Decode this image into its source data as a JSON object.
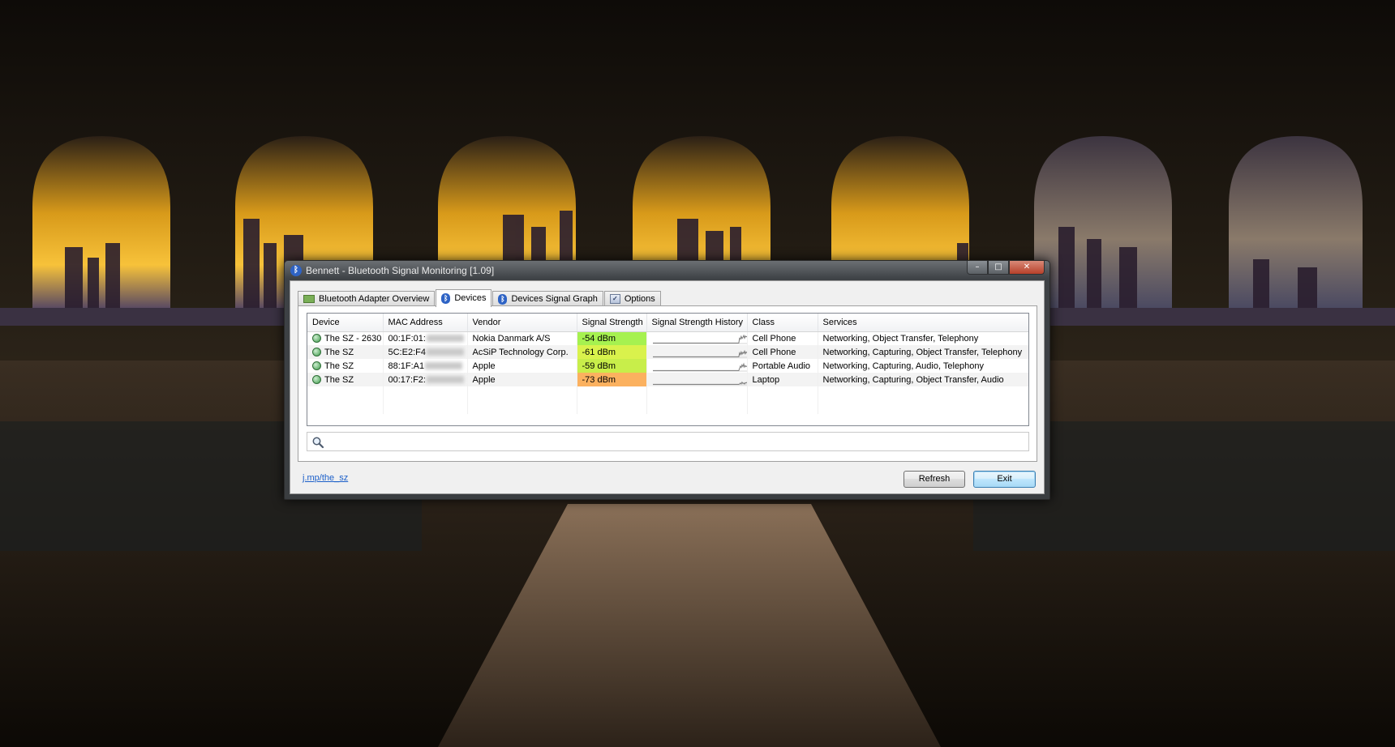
{
  "window": {
    "title": "Bennett - Bluetooth Signal Monitoring [1.09]",
    "controls": {
      "minimize": "–",
      "maximize": "□",
      "close": "✕"
    }
  },
  "tabs": [
    {
      "label": "Bluetooth Adapter Overview",
      "icon": "adapter-icon",
      "active": false
    },
    {
      "label": "Devices",
      "icon": "bluetooth-icon",
      "active": true
    },
    {
      "label": "Devices Signal Graph",
      "icon": "bluetooth-icon",
      "active": false
    },
    {
      "label": "Options",
      "icon": "options-icon",
      "active": false
    }
  ],
  "devices": {
    "columns": [
      "Device",
      "MAC Address",
      "Vendor",
      "Signal Strength",
      "Signal Strength History",
      "Class",
      "Services"
    ],
    "rows": [
      {
        "device": "The SZ - 2630",
        "mac": "00:1F:01:",
        "vendor": "Nokia Danmark A/S",
        "signal": "-54 dBm",
        "signal_color": "#a6f150",
        "history": [
          0.05,
          0.05,
          0.05,
          0.05,
          0.05,
          0.05,
          0.05,
          0.05,
          0.05,
          0.05,
          0.05,
          0.05,
          0.05,
          0.05,
          0.05,
          0.05,
          0.05,
          0.05,
          0.05,
          0.05,
          0.05,
          0.05,
          0.05,
          0.05,
          0.05,
          0.05,
          0.05,
          0.05,
          0.05,
          0.05,
          0.05,
          0.05,
          0.05,
          0.05,
          0.05,
          0.05,
          0.05,
          0.05,
          0.05,
          0.05,
          0.05,
          0.05,
          0.05,
          0.05,
          0.05,
          0.05,
          0.05,
          0.05,
          0.05,
          0.05,
          0.05,
          0.05,
          0.05,
          0.05,
          0.05,
          0.05,
          0.05,
          0.05,
          0.05,
          0.05,
          0.05,
          0.05,
          0.05,
          0.05,
          0.05,
          0.05,
          0.05,
          0.05,
          0.05,
          0.05,
          0.05,
          0.05,
          0.05,
          0.05,
          0.05,
          0.05,
          0.05,
          0.05,
          0.05,
          0.05,
          0.05,
          0.05,
          0.05,
          0.05,
          0.05,
          0.05,
          0.05,
          0.05,
          0.05,
          0.05,
          0.05,
          0.05,
          0.05,
          0.05,
          0.05,
          0.05,
          0.05,
          0.05,
          0.05,
          0.05,
          0.05,
          0.05,
          0.05,
          0.05,
          0.05,
          0.05,
          0.6,
          0.5,
          0.8,
          0.55,
          0.7,
          0.9,
          0.6,
          0.85,
          0.75,
          0.8
        ],
        "class": "Cell Phone",
        "services": "Networking, Object Transfer, Telephony"
      },
      {
        "device": "The SZ",
        "mac": "5C:E2:F4",
        "vendor": "AcSiP Technology Corp.",
        "signal": "-61 dBm",
        "signal_color": "#d9f24c",
        "history": [
          0.05,
          0.05,
          0.05,
          0.05,
          0.05,
          0.05,
          0.05,
          0.05,
          0.05,
          0.05,
          0.05,
          0.05,
          0.05,
          0.05,
          0.05,
          0.05,
          0.05,
          0.05,
          0.05,
          0.05,
          0.05,
          0.05,
          0.05,
          0.05,
          0.05,
          0.05,
          0.05,
          0.05,
          0.05,
          0.05,
          0.05,
          0.05,
          0.05,
          0.05,
          0.05,
          0.05,
          0.05,
          0.05,
          0.05,
          0.05,
          0.05,
          0.05,
          0.05,
          0.05,
          0.05,
          0.05,
          0.05,
          0.05,
          0.05,
          0.05,
          0.05,
          0.05,
          0.05,
          0.05,
          0.05,
          0.05,
          0.05,
          0.05,
          0.05,
          0.05,
          0.05,
          0.05,
          0.05,
          0.05,
          0.05,
          0.05,
          0.05,
          0.05,
          0.05,
          0.05,
          0.05,
          0.05,
          0.05,
          0.05,
          0.05,
          0.05,
          0.05,
          0.05,
          0.05,
          0.05,
          0.05,
          0.05,
          0.05,
          0.05,
          0.05,
          0.05,
          0.05,
          0.05,
          0.05,
          0.05,
          0.05,
          0.05,
          0.05,
          0.05,
          0.05,
          0.05,
          0.05,
          0.05,
          0.05,
          0.05,
          0.05,
          0.05,
          0.05,
          0.05,
          0.05,
          0.05,
          0.5,
          0.3,
          0.6,
          0.35,
          0.55,
          0.45,
          0.7,
          0.4,
          0.6,
          0.5
        ],
        "class": "Cell Phone",
        "services": "Networking, Capturing, Object Transfer, Telephony"
      },
      {
        "device": "The SZ",
        "mac": "88:1F:A1",
        "vendor": "Apple",
        "signal": "-59 dBm",
        "signal_color": "#c8ee4a",
        "history": [
          0.05,
          0.05,
          0.05,
          0.05,
          0.05,
          0.05,
          0.05,
          0.05,
          0.05,
          0.05,
          0.05,
          0.05,
          0.05,
          0.05,
          0.05,
          0.05,
          0.05,
          0.05,
          0.05,
          0.05,
          0.05,
          0.05,
          0.05,
          0.05,
          0.05,
          0.05,
          0.05,
          0.05,
          0.05,
          0.05,
          0.05,
          0.05,
          0.05,
          0.05,
          0.05,
          0.05,
          0.05,
          0.05,
          0.05,
          0.05,
          0.05,
          0.05,
          0.05,
          0.05,
          0.05,
          0.05,
          0.05,
          0.05,
          0.05,
          0.05,
          0.05,
          0.05,
          0.05,
          0.05,
          0.05,
          0.05,
          0.05,
          0.05,
          0.05,
          0.05,
          0.05,
          0.05,
          0.05,
          0.05,
          0.05,
          0.05,
          0.05,
          0.05,
          0.05,
          0.05,
          0.05,
          0.05,
          0.05,
          0.05,
          0.05,
          0.05,
          0.05,
          0.05,
          0.05,
          0.05,
          0.05,
          0.05,
          0.05,
          0.05,
          0.05,
          0.05,
          0.05,
          0.05,
          0.05,
          0.05,
          0.05,
          0.05,
          0.05,
          0.05,
          0.05,
          0.05,
          0.05,
          0.05,
          0.05,
          0.05,
          0.05,
          0.05,
          0.05,
          0.05,
          0.05,
          0.05,
          0.3,
          0.55,
          0.4,
          0.7,
          0.5,
          0.8,
          0.45,
          0.6,
          0.5,
          0.55
        ],
        "class": "Portable Audio",
        "services": "Networking, Capturing, Audio, Telephony"
      },
      {
        "device": "The SZ",
        "mac": "00:17:F2:",
        "vendor": "Apple",
        "signal": "-73 dBm",
        "signal_color": "#fbb15f",
        "history": [
          0.05,
          0.05,
          0.05,
          0.05,
          0.05,
          0.05,
          0.05,
          0.05,
          0.05,
          0.05,
          0.05,
          0.05,
          0.05,
          0.05,
          0.05,
          0.05,
          0.05,
          0.05,
          0.05,
          0.05,
          0.05,
          0.05,
          0.05,
          0.05,
          0.05,
          0.05,
          0.05,
          0.05,
          0.05,
          0.05,
          0.05,
          0.05,
          0.05,
          0.05,
          0.05,
          0.05,
          0.05,
          0.05,
          0.05,
          0.05,
          0.05,
          0.05,
          0.05,
          0.05,
          0.05,
          0.05,
          0.05,
          0.05,
          0.05,
          0.05,
          0.05,
          0.05,
          0.05,
          0.05,
          0.05,
          0.05,
          0.05,
          0.05,
          0.05,
          0.05,
          0.05,
          0.05,
          0.05,
          0.05,
          0.05,
          0.05,
          0.05,
          0.05,
          0.05,
          0.05,
          0.05,
          0.05,
          0.05,
          0.05,
          0.05,
          0.05,
          0.05,
          0.05,
          0.05,
          0.05,
          0.05,
          0.05,
          0.05,
          0.05,
          0.05,
          0.05,
          0.05,
          0.05,
          0.05,
          0.05,
          0.05,
          0.05,
          0.05,
          0.05,
          0.05,
          0.05,
          0.05,
          0.05,
          0.05,
          0.05,
          0.05,
          0.05,
          0.05,
          0.05,
          0.05,
          0.05,
          0.1,
          0.2,
          0.1,
          0.3,
          0.15,
          0.2,
          0.1,
          0.25,
          0.2,
          0.3
        ],
        "class": "Laptop",
        "services": "Networking, Capturing, Object Transfer, Audio"
      }
    ]
  },
  "search": {
    "value": "",
    "placeholder": ""
  },
  "footer": {
    "link": "j.mp/the_sz",
    "refresh_label": "Refresh",
    "exit_label": "Exit"
  }
}
